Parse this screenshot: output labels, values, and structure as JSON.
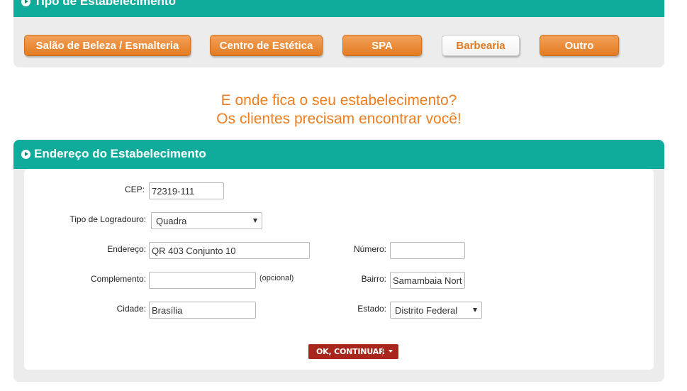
{
  "business_type_panel": {
    "title": "Tipo de Estabelecimento",
    "options": [
      {
        "label": "Salão de Beleza / Esmalteria"
      },
      {
        "label": "Centro de Estética"
      },
      {
        "label": "SPA"
      },
      {
        "label": "Barbearia"
      },
      {
        "label": "Outro"
      }
    ],
    "selected": "Barbearia"
  },
  "headline": {
    "line1": "E onde fica o seu estabelecimento?",
    "line2": "Os clientes precisam encontrar você!"
  },
  "address_panel": {
    "title": "Endereço do Estabelecimento",
    "cep": {
      "label": "CEP:",
      "value": "72319-111"
    },
    "street_type": {
      "label": "Tipo de Logradouro:",
      "value": "Quadra"
    },
    "address": {
      "label": "Endereço:",
      "value": "QR 403 Conjunto 10"
    },
    "number": {
      "label": "Número:",
      "value": ""
    },
    "complement": {
      "label": "Complemento:",
      "value": "",
      "hint": "(opcional)"
    },
    "neighborhood": {
      "label": "Bairro:",
      "value": "Samambaia Norte"
    },
    "city": {
      "label": "Cidade:",
      "value": "Brasília"
    },
    "state": {
      "label": "Estado:",
      "value": "Distrito Federal"
    },
    "submit_label": "OK, CONTINUAR"
  },
  "colors": {
    "teal_header": "#0fac9c",
    "orange_button": "#e8872d",
    "orange_text": "#f07d1e",
    "submit_red": "#a8261b",
    "panel_gray": "#ececec"
  },
  "icons": {
    "panel_bullet": "play-circle-icon",
    "dropdown": "caret-down-icon"
  }
}
